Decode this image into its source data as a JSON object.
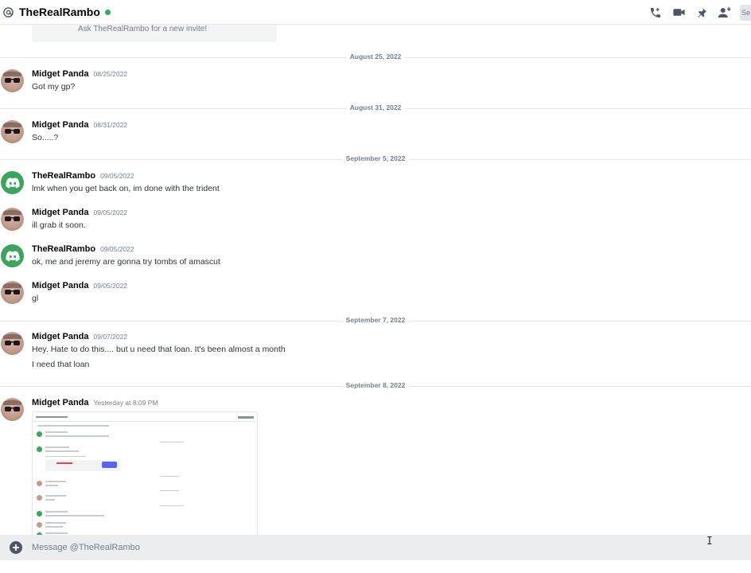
{
  "header": {
    "title": "TheRealRambo",
    "search_stub": "Se"
  },
  "invite": {
    "text": "Ask TheRealRambo for a new invite!"
  },
  "dividers": [
    {
      "label": "August 25, 2022"
    },
    {
      "label": "August 31, 2022"
    },
    {
      "label": "September 5, 2022"
    },
    {
      "label": "September 7, 2022"
    },
    {
      "label": "September 8, 2022"
    }
  ],
  "messages": [
    {
      "author": "Midget Panda",
      "timestamp": "08/25/2022",
      "lines": [
        "Got my gp?"
      ]
    },
    {
      "author": "Midget Panda",
      "timestamp": "08/31/2022",
      "lines": [
        "So.....?"
      ]
    },
    {
      "author": "TheRealRambo",
      "timestamp": "09/05/2022",
      "lines": [
        "lmk when you get back on, im done with the trident"
      ]
    },
    {
      "author": "Midget Panda",
      "timestamp": "09/05/2022",
      "lines": [
        "ill grab it soon."
      ]
    },
    {
      "author": "TheRealRambo",
      "timestamp": "09/05/2022",
      "lines": [
        "ok, me and jeremy are gonna try tombs of amascut"
      ]
    },
    {
      "author": "Midget Panda",
      "timestamp": "09/05/2022",
      "lines": [
        "gl"
      ]
    },
    {
      "author": "Midget Panda",
      "timestamp": "09/07/2022",
      "lines": [
        "Hey. Hate to do this.... but u need that loan. It's been almost a month",
        "I need that loan"
      ]
    },
    {
      "author": "Midget Panda",
      "timestamp": "Yesterday at 8:09 PM",
      "lines": []
    }
  ],
  "composer": {
    "placeholder": "Message @TheRealRambo"
  },
  "icons": {
    "header": [
      "at-icon",
      "call-icon",
      "video-icon",
      "pin-icon",
      "add-friend-icon"
    ],
    "composer": [
      "plus-icon"
    ]
  },
  "colors": {
    "online": "#3ba55d",
    "accent": "#5865f2",
    "discord_avatar": "#3ba55d"
  }
}
